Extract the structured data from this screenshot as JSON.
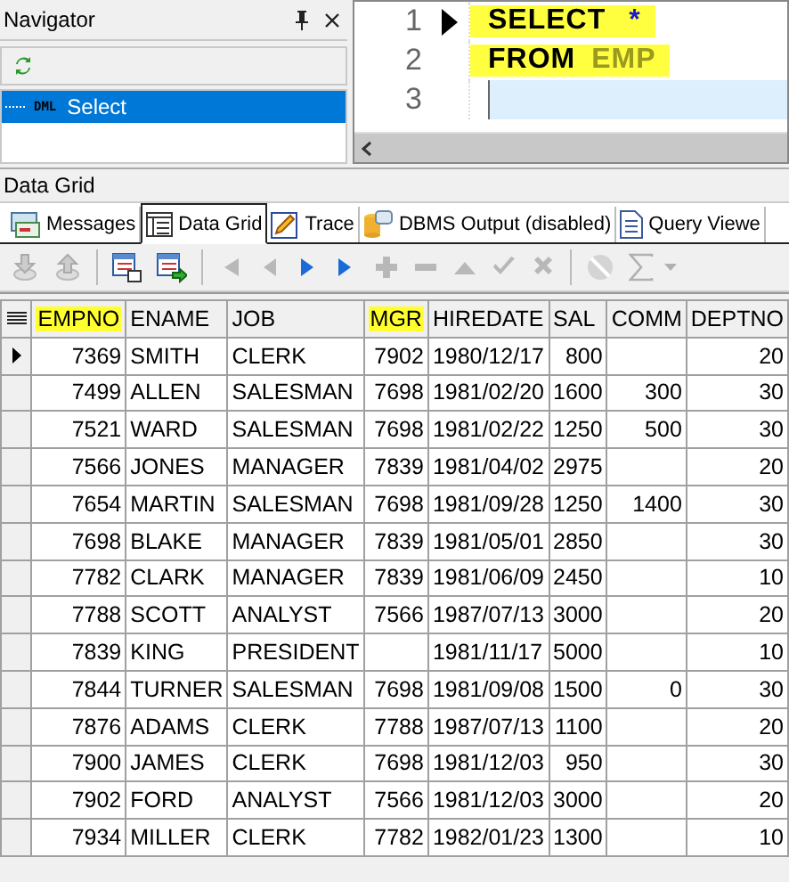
{
  "navigator": {
    "title": "Navigator",
    "items": [
      {
        "badge": "DML",
        "label": "Select",
        "selected": true
      }
    ]
  },
  "editor": {
    "lines": [
      {
        "number": "1",
        "current": true,
        "highlighted": true,
        "tokens": [
          {
            "kind": "keyword",
            "text": "SELECT"
          },
          {
            "kind": "operator",
            "text": "*"
          }
        ]
      },
      {
        "number": "2",
        "current": false,
        "highlighted": true,
        "tokens": [
          {
            "kind": "keyword",
            "text": "FROM"
          },
          {
            "kind": "identifier",
            "text": "EMP"
          }
        ]
      },
      {
        "number": "3",
        "current": false,
        "highlighted": false
      }
    ]
  },
  "panel_title": "Data Grid",
  "tabs": [
    {
      "kind": "messages",
      "label": "Messages",
      "selected": false
    },
    {
      "kind": "grid",
      "label": "Data Grid",
      "selected": true
    },
    {
      "kind": "trace",
      "label": "Trace",
      "selected": false
    },
    {
      "kind": "dbms",
      "label": "DBMS Output (disabled)",
      "selected": false
    },
    {
      "kind": "document",
      "label": "Query Viewe",
      "selected": false
    }
  ],
  "toolbar": [
    {
      "kind": "import",
      "disabled": true
    },
    {
      "kind": "export",
      "disabled": true
    },
    {
      "kind": "separator"
    },
    {
      "kind": "grid-edit",
      "disabled": false
    },
    {
      "kind": "grid-export",
      "disabled": false
    },
    {
      "kind": "separator"
    },
    {
      "kind": "first",
      "disabled": true
    },
    {
      "kind": "prev",
      "disabled": true
    },
    {
      "kind": "next",
      "disabled": false
    },
    {
      "kind": "last",
      "disabled": false
    },
    {
      "kind": "insert",
      "disabled": true
    },
    {
      "kind": "delete",
      "disabled": true
    },
    {
      "kind": "up",
      "disabled": true
    },
    {
      "kind": "post",
      "disabled": true
    },
    {
      "kind": "cancel",
      "disabled": true
    },
    {
      "kind": "separator"
    },
    {
      "kind": "filter",
      "disabled": true
    },
    {
      "kind": "sum",
      "disabled": true
    },
    {
      "kind": "dropdown",
      "disabled": true
    }
  ],
  "table": {
    "columns": [
      {
        "label": "EMPNO",
        "kind": "number",
        "highlighted": true
      },
      {
        "label": "ENAME",
        "kind": "text",
        "highlighted": false
      },
      {
        "label": "JOB",
        "kind": "text",
        "highlighted": false
      },
      {
        "label": "MGR",
        "kind": "number",
        "highlighted": true
      },
      {
        "label": "HIREDATE",
        "kind": "text",
        "highlighted": false
      },
      {
        "label": "SAL",
        "kind": "number",
        "highlighted": false
      },
      {
        "label": "COMM",
        "kind": "number",
        "highlighted": false
      },
      {
        "label": "DEPTNO",
        "kind": "number",
        "highlighted": false
      }
    ],
    "rows": [
      {
        "current": true,
        "cells": [
          "7369",
          "SMITH",
          "CLERK",
          "7902",
          "1980/12/17",
          "800",
          null,
          "20"
        ]
      },
      {
        "current": false,
        "cells": [
          "7499",
          "ALLEN",
          "SALESMAN",
          "7698",
          "1981/02/20",
          "1600",
          "300",
          "30"
        ]
      },
      {
        "current": false,
        "cells": [
          "7521",
          "WARD",
          "SALESMAN",
          "7698",
          "1981/02/22",
          "1250",
          "500",
          "30"
        ]
      },
      {
        "current": false,
        "cells": [
          "7566",
          "JONES",
          "MANAGER",
          "7839",
          "1981/04/02",
          "2975",
          null,
          "20"
        ]
      },
      {
        "current": false,
        "cells": [
          "7654",
          "MARTIN",
          "SALESMAN",
          "7698",
          "1981/09/28",
          "1250",
          "1400",
          "30"
        ]
      },
      {
        "current": false,
        "cells": [
          "7698",
          "BLAKE",
          "MANAGER",
          "7839",
          "1981/05/01",
          "2850",
          null,
          "30"
        ]
      },
      {
        "current": false,
        "cells": [
          "7782",
          "CLARK",
          "MANAGER",
          "7839",
          "1981/06/09",
          "2450",
          null,
          "10"
        ]
      },
      {
        "current": false,
        "cells": [
          "7788",
          "SCOTT",
          "ANALYST",
          "7566",
          "1987/07/13",
          "3000",
          null,
          "20"
        ]
      },
      {
        "current": false,
        "cells": [
          "7839",
          "KING",
          "PRESIDENT",
          null,
          "1981/11/17",
          "5000",
          null,
          "10"
        ]
      },
      {
        "current": false,
        "cells": [
          "7844",
          "TURNER",
          "SALESMAN",
          "7698",
          "1981/09/08",
          "1500",
          "0",
          "30"
        ]
      },
      {
        "current": false,
        "cells": [
          "7876",
          "ADAMS",
          "CLERK",
          "7788",
          "1987/07/13",
          "1100",
          null,
          "20"
        ]
      },
      {
        "current": false,
        "cells": [
          "7900",
          "JAMES",
          "CLERK",
          "7698",
          "1981/12/03",
          "950",
          null,
          "30"
        ]
      },
      {
        "current": false,
        "cells": [
          "7902",
          "FORD",
          "ANALYST",
          "7566",
          "1981/12/03",
          "3000",
          null,
          "20"
        ]
      },
      {
        "current": false,
        "cells": [
          "7934",
          "MILLER",
          "CLERK",
          "7782",
          "1982/01/23",
          "1300",
          null,
          "10"
        ]
      }
    ]
  }
}
